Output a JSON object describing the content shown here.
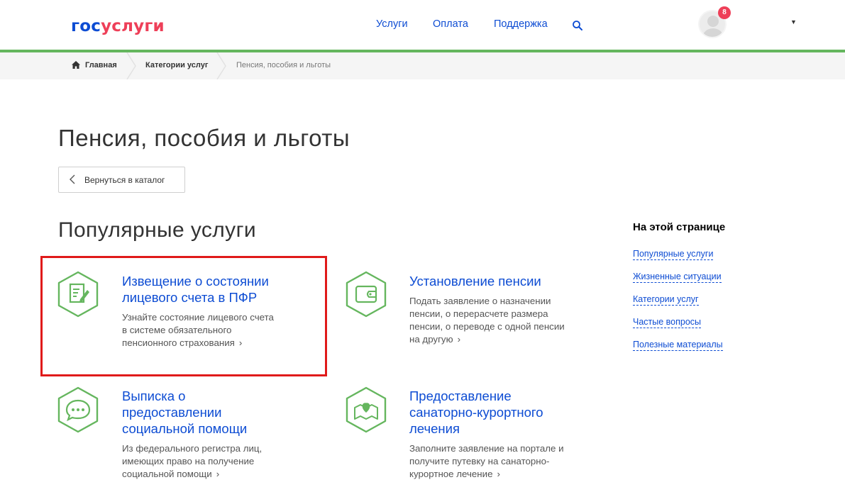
{
  "header": {
    "logo_part1": "гос",
    "logo_part2": "услуги",
    "nav": [
      "Услуги",
      "Оплата",
      "Поддержка"
    ],
    "notifications_count": "8"
  },
  "breadcrumb": [
    "Главная",
    "Категории услуг",
    "Пенсия, пособия и льготы"
  ],
  "page_title": "Пенсия, пособия и льготы",
  "back_button": "Вернуться в каталог",
  "section_title": "Популярные услуги",
  "cards": [
    {
      "title_lines": [
        "Извещение о состоянии",
        "лицевого счета в ПФР"
      ],
      "desc_lines": [
        "Узнайте состояние лицевого счета",
        "в системе обязательного",
        "пенсионного страхования"
      ],
      "icon": "document-edit-icon"
    },
    {
      "title_lines": [
        "Установление пенсии"
      ],
      "desc_lines": [
        "Подать заявление о назначении",
        "пенсии, о перерасчете размера",
        "пенсии, о переводе с одной пенсии",
        "на другую"
      ],
      "icon": "wallet-icon"
    },
    {
      "title_lines": [
        "Выписка о",
        "предоставлении",
        "социальной помощи"
      ],
      "desc_lines": [
        "Из федерального регистра лиц,",
        "имеющих право на получение",
        "социальной помощи"
      ],
      "icon": "chat-bubble-icon"
    },
    {
      "title_lines": [
        "Предоставление",
        "санаторно-курортного",
        "лечения"
      ],
      "desc_lines": [
        "Заполните заявление на портале и",
        "получите путевку на санаторно-",
        "курортное лечение"
      ],
      "icon": "heart-map-icon"
    }
  ],
  "sidebar": {
    "title": "На этой странице",
    "links": [
      "Популярные услуги",
      "Жизненные ситуации",
      "Категории услуг",
      "Частые вопросы",
      "Полезные материалы"
    ]
  },
  "colors": {
    "brand_blue": "#0d4cd3",
    "brand_red": "#ee3f58",
    "green": "#65b65e",
    "highlight_red": "#e01a1a"
  }
}
